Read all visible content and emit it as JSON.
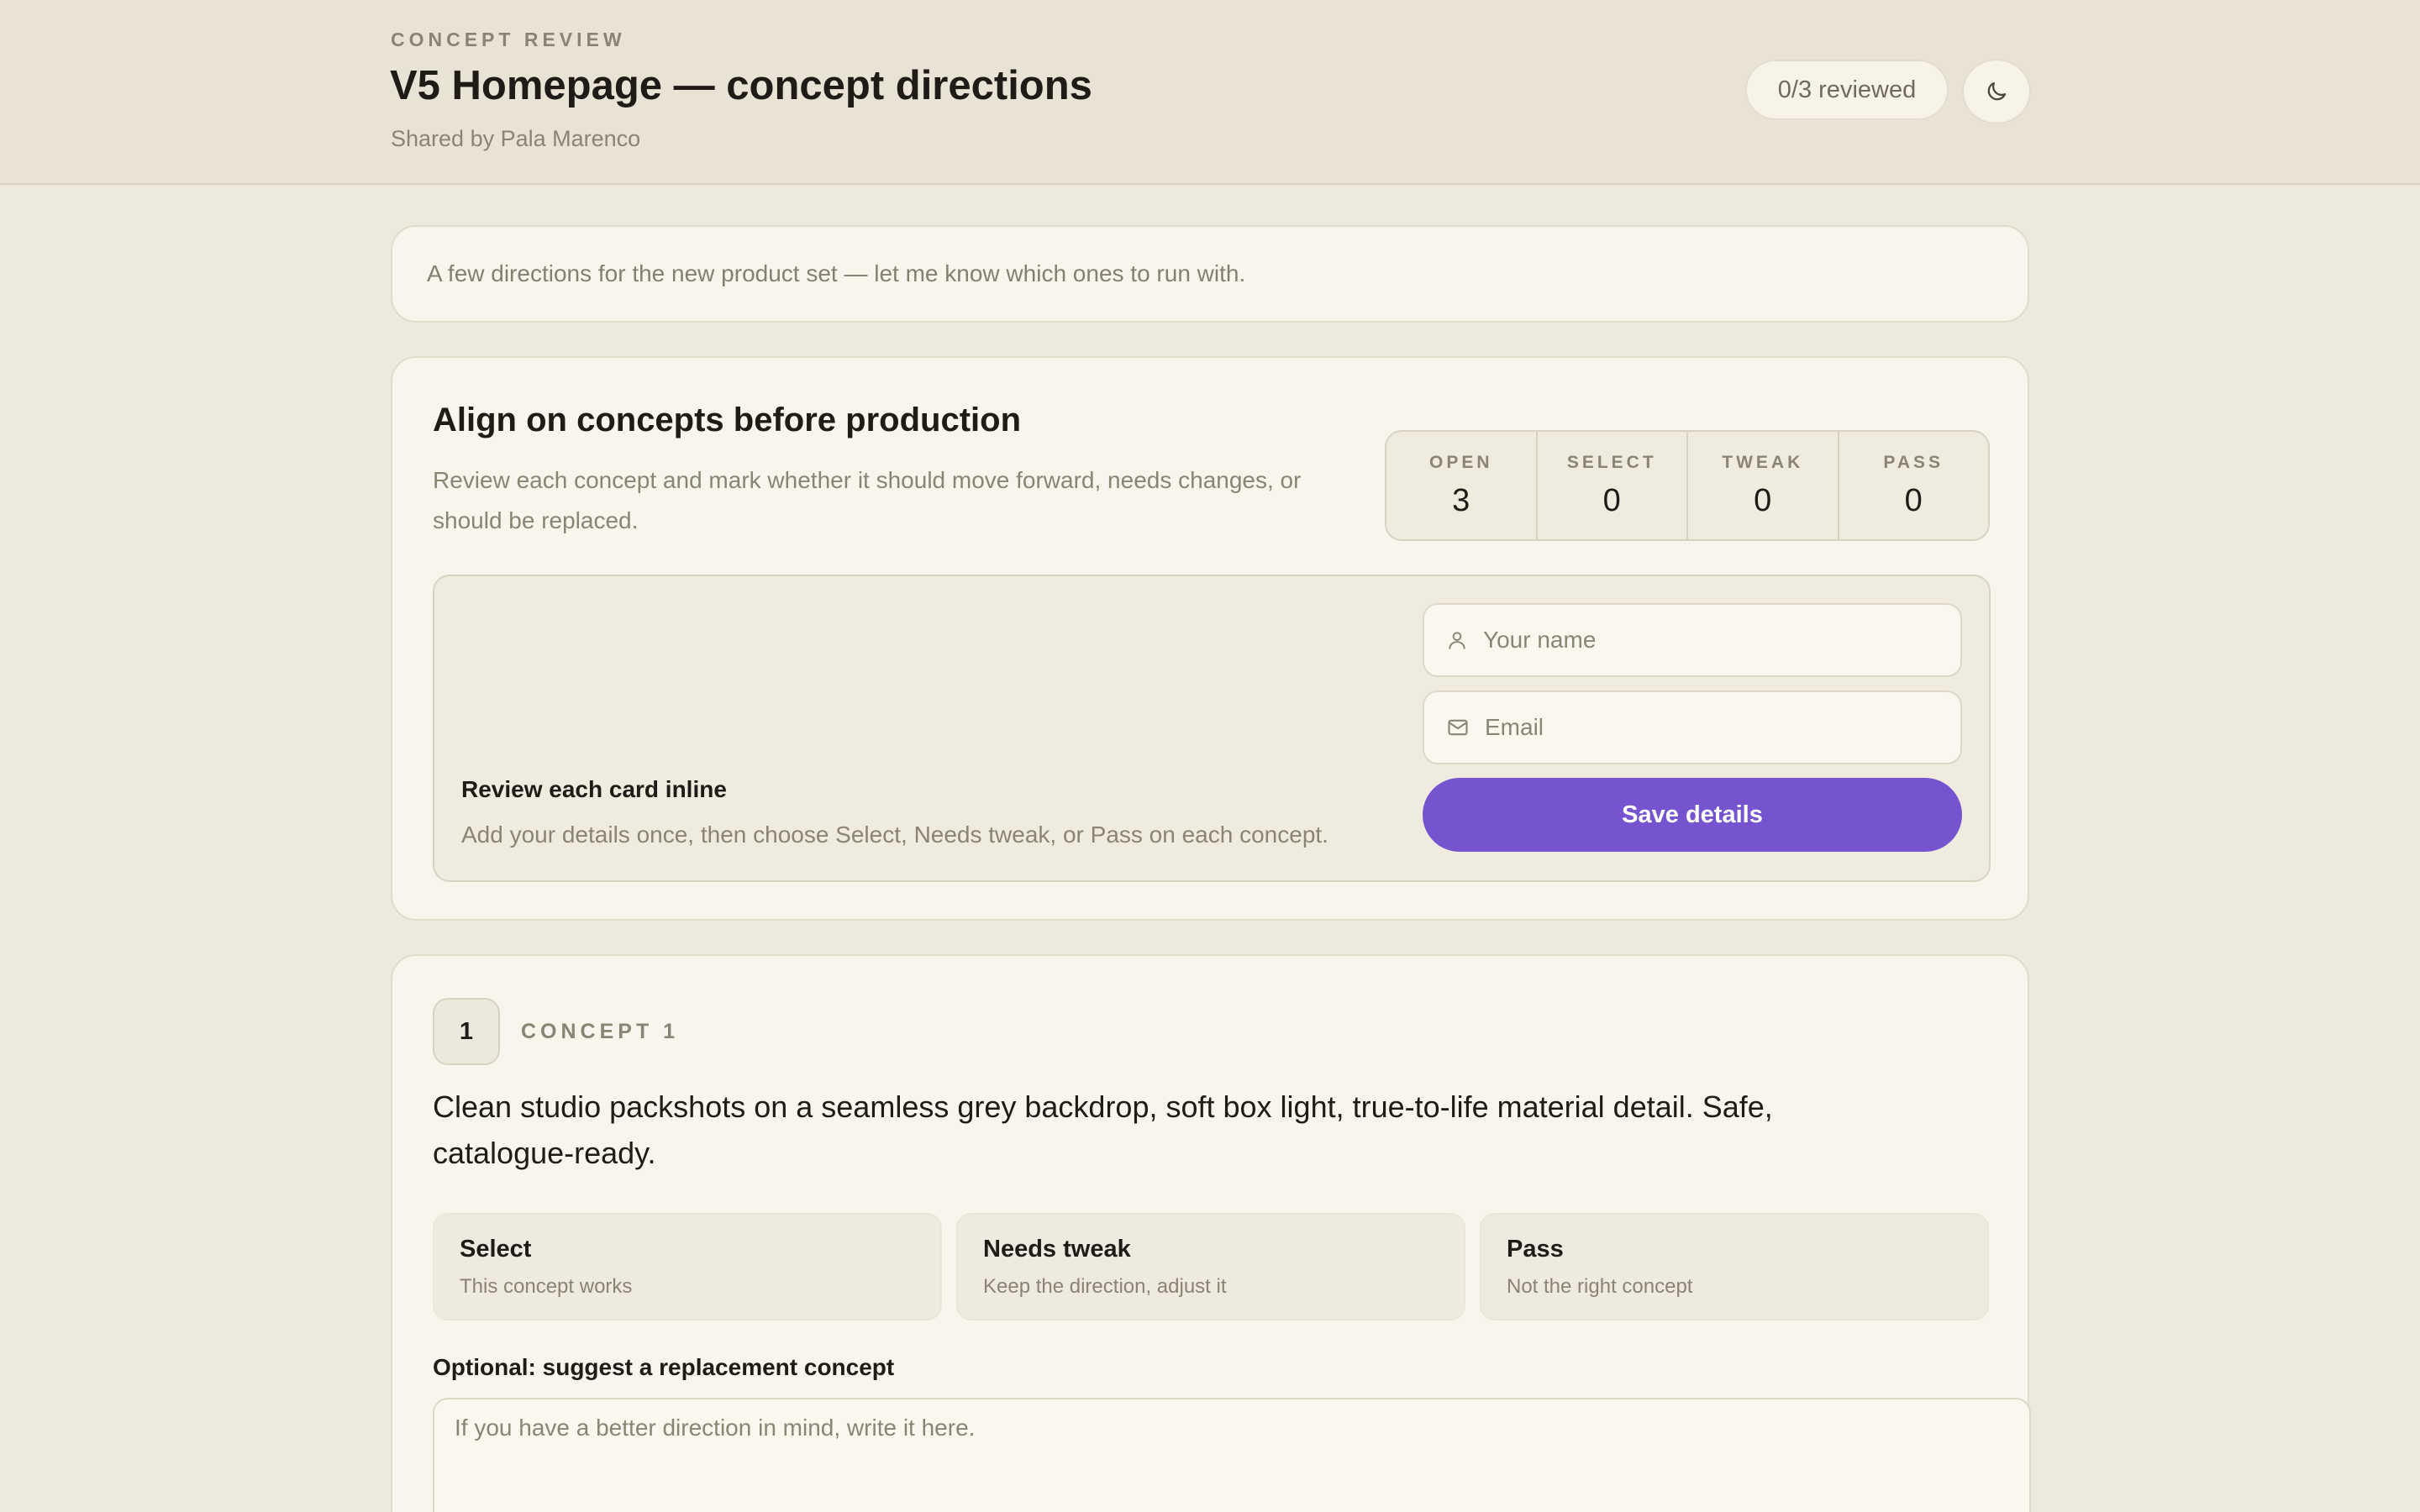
{
  "header": {
    "eyebrow": "CONCEPT REVIEW",
    "title": "V5 Homepage — concept directions",
    "shared_by": "Shared by Pala Marenco",
    "reviewed_status": "0/3 reviewed",
    "theme_icon": "moon-icon"
  },
  "note": {
    "text": "A few directions for the new product set — let me know which ones to run with."
  },
  "align": {
    "title": "Align on concepts before production",
    "description": "Review each concept and mark whether it should move forward, needs changes, or should be replaced.",
    "stats": [
      {
        "label": "OPEN",
        "value": "3"
      },
      {
        "label": "SELECT",
        "value": "0"
      },
      {
        "label": "TWEAK",
        "value": "0"
      },
      {
        "label": "PASS",
        "value": "0"
      }
    ],
    "details": {
      "title": "Review each card inline",
      "description": "Add your details once, then choose Select, Needs tweak, or Pass on each concept.",
      "name_placeholder": "Your name",
      "name_icon": "user-icon",
      "email_placeholder": "Email",
      "email_icon": "mail-icon",
      "save_label": "Save details"
    }
  },
  "concepts": [
    {
      "number": "1",
      "label": "CONCEPT 1",
      "text": "Clean studio packshots on a seamless grey backdrop, soft box light, true-to-life material detail. Safe, catalogue-ready.",
      "options": [
        {
          "title": "Select",
          "subtitle": "This concept works"
        },
        {
          "title": "Needs tweak",
          "subtitle": "Keep the direction, adjust it"
        },
        {
          "title": "Pass",
          "subtitle": "Not the right concept"
        }
      ],
      "replacement_label": "Optional: suggest a replacement concept",
      "replacement_placeholder": "If you have a better direction in mind, write it here."
    }
  ],
  "colors": {
    "accent": "#7654cf",
    "background": "#ede9dd",
    "card": "#f8f5ec"
  }
}
